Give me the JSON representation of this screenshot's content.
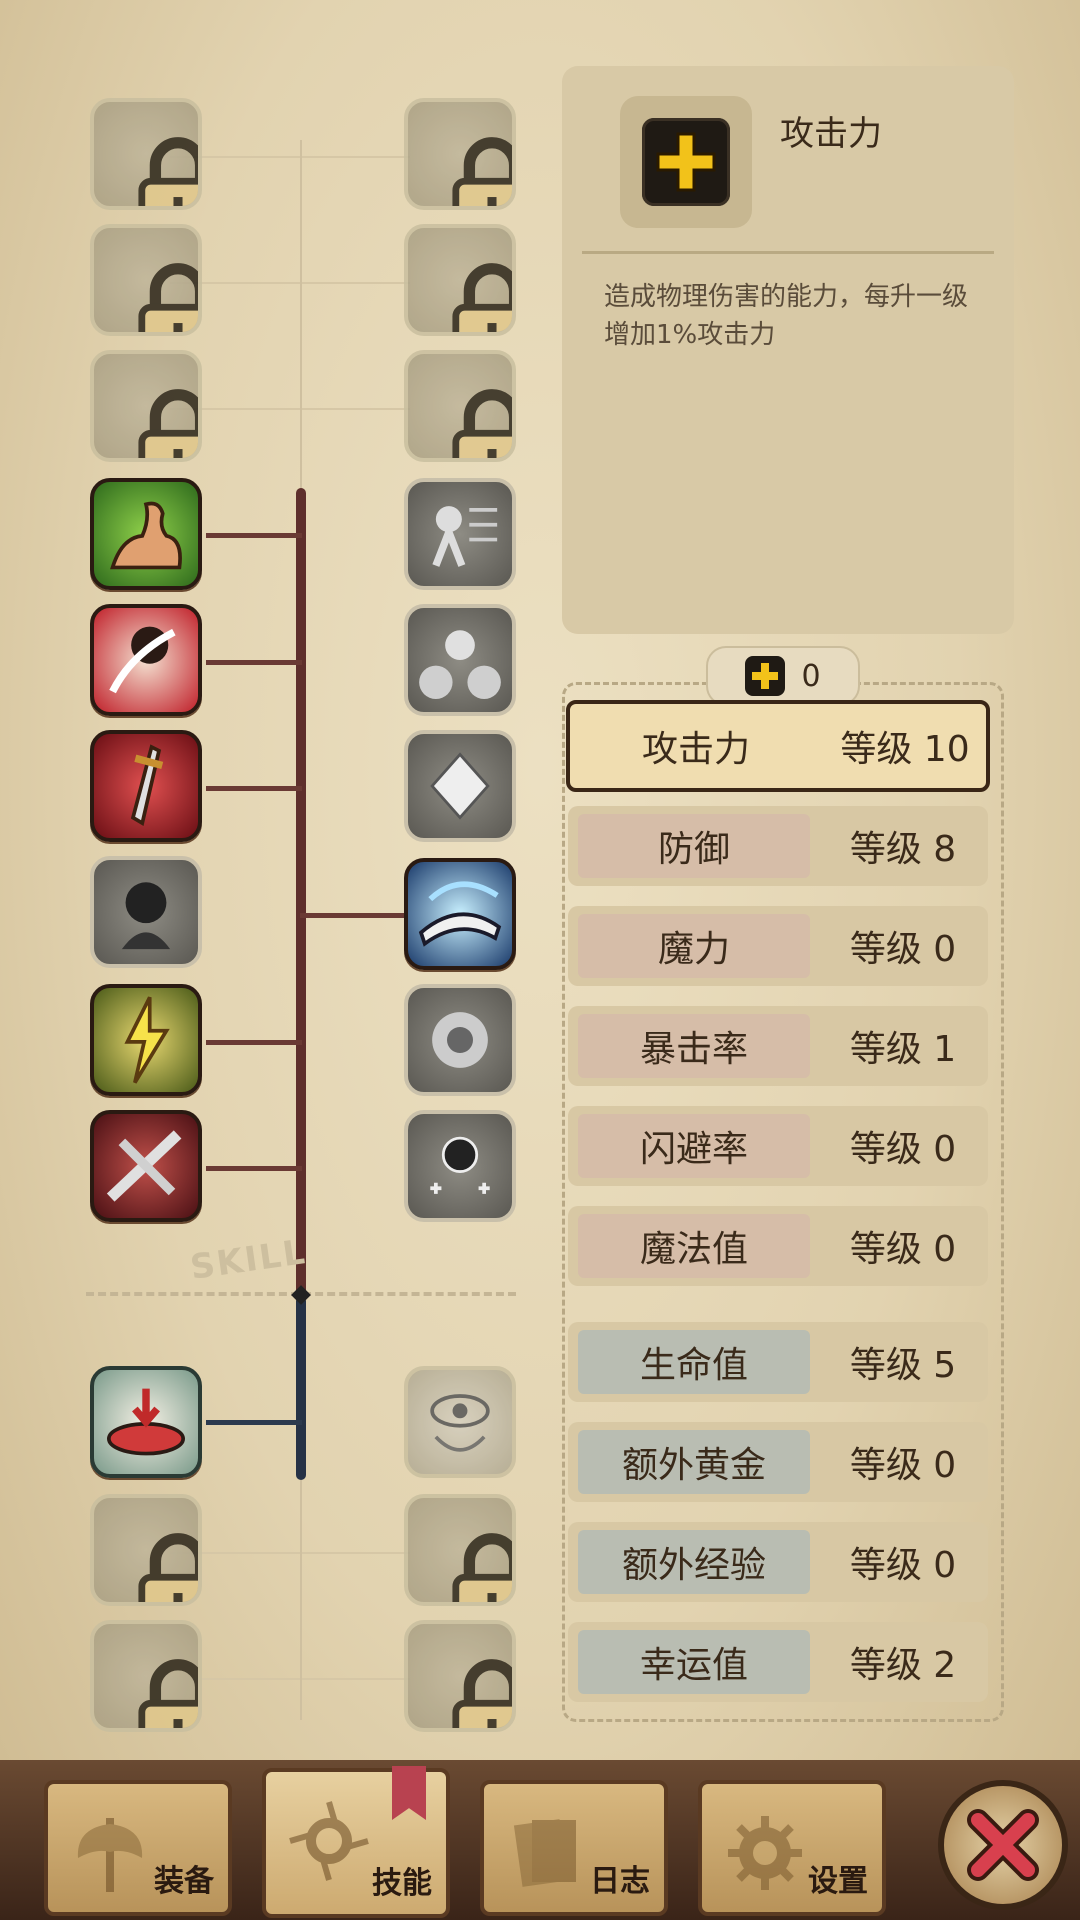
{
  "info": {
    "title": "攻击力",
    "description": "造成物理伤害的能力，每升一级增加1%攻击力"
  },
  "points": {
    "value": "0"
  },
  "stats": [
    {
      "name": "攻击力",
      "level": "等级 10",
      "selected": true
    },
    {
      "name": "防御",
      "level": "等级 8"
    },
    {
      "name": "魔力",
      "level": "等级 0"
    },
    {
      "name": "暴击率",
      "level": "等级 1"
    },
    {
      "name": "闪避率",
      "level": "等级 0"
    },
    {
      "name": "魔法值",
      "level": "等级 0"
    },
    {
      "name": "生命值",
      "level": "等级 5"
    },
    {
      "name": "额外黄金",
      "level": "等级 0"
    },
    {
      "name": "额外经验",
      "level": "等级 0"
    },
    {
      "name": "幸运值",
      "level": "等级 2"
    }
  ],
  "skill_tree": {
    "divider_text": "SKILL"
  },
  "nav": {
    "tabs": [
      {
        "label": "装备"
      },
      {
        "label": "技能",
        "active": true
      },
      {
        "label": "日志"
      },
      {
        "label": "设置"
      }
    ]
  },
  "colors": {
    "accent_yellow": "#f2c21a",
    "close_red": "#c8384a"
  }
}
